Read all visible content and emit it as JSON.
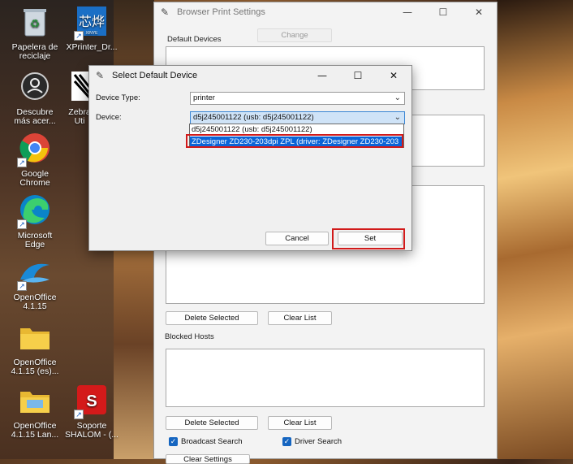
{
  "desktop": {
    "icons": [
      {
        "label": "Papelera de reciclaje",
        "icon": "recycle-bin-icon"
      },
      {
        "label": "XPrinter_Dr...",
        "icon": "xprinter-icon"
      },
      {
        "label": "Descubre más acer...",
        "icon": "acer-icon"
      },
      {
        "label": "Zebra Uti",
        "icon": "zebra-icon"
      },
      {
        "label": "Google Chrome",
        "icon": "chrome-icon"
      },
      {
        "label": "Microsoft Edge",
        "icon": "edge-icon"
      },
      {
        "label": "OpenOffice 4.1.15",
        "icon": "openoffice-icon"
      },
      {
        "label": "OpenOffice 4.1.15 (es)...",
        "icon": "folder-icon"
      },
      {
        "label": "OpenOffice 4.1.15 Lan...",
        "icon": "folder-icon"
      },
      {
        "label": "Soporte SHALOM - (...",
        "icon": "support-icon"
      }
    ]
  },
  "main_window": {
    "title": "Browser Print Settings",
    "default_devices_label": "Default Devices",
    "change_label": "Change",
    "delete_selected_label": "Delete Selected",
    "clear_list_label": "Clear List",
    "blocked_hosts_label": "Blocked Hosts",
    "broadcast_search_label": "Broadcast Search",
    "driver_search_label": "Driver Search",
    "clear_settings_label": "Clear Settings"
  },
  "dialog": {
    "title": "Select Default Device",
    "device_type_label": "Device Type:",
    "device_type_value": "printer",
    "device_label": "Device:",
    "device_value": "d5j245001122 (usb: d5j245001122)",
    "options": [
      "d5j245001122 (usb: d5j245001122)",
      "ZDesigner ZD230-203dpi ZPL (driver: ZDesigner ZD230-203"
    ],
    "cancel_label": "Cancel",
    "set_label": "Set"
  },
  "colors": {
    "highlight": "#d11a1a",
    "selection": "#0a64d8",
    "checkbox": "#1565c0"
  }
}
